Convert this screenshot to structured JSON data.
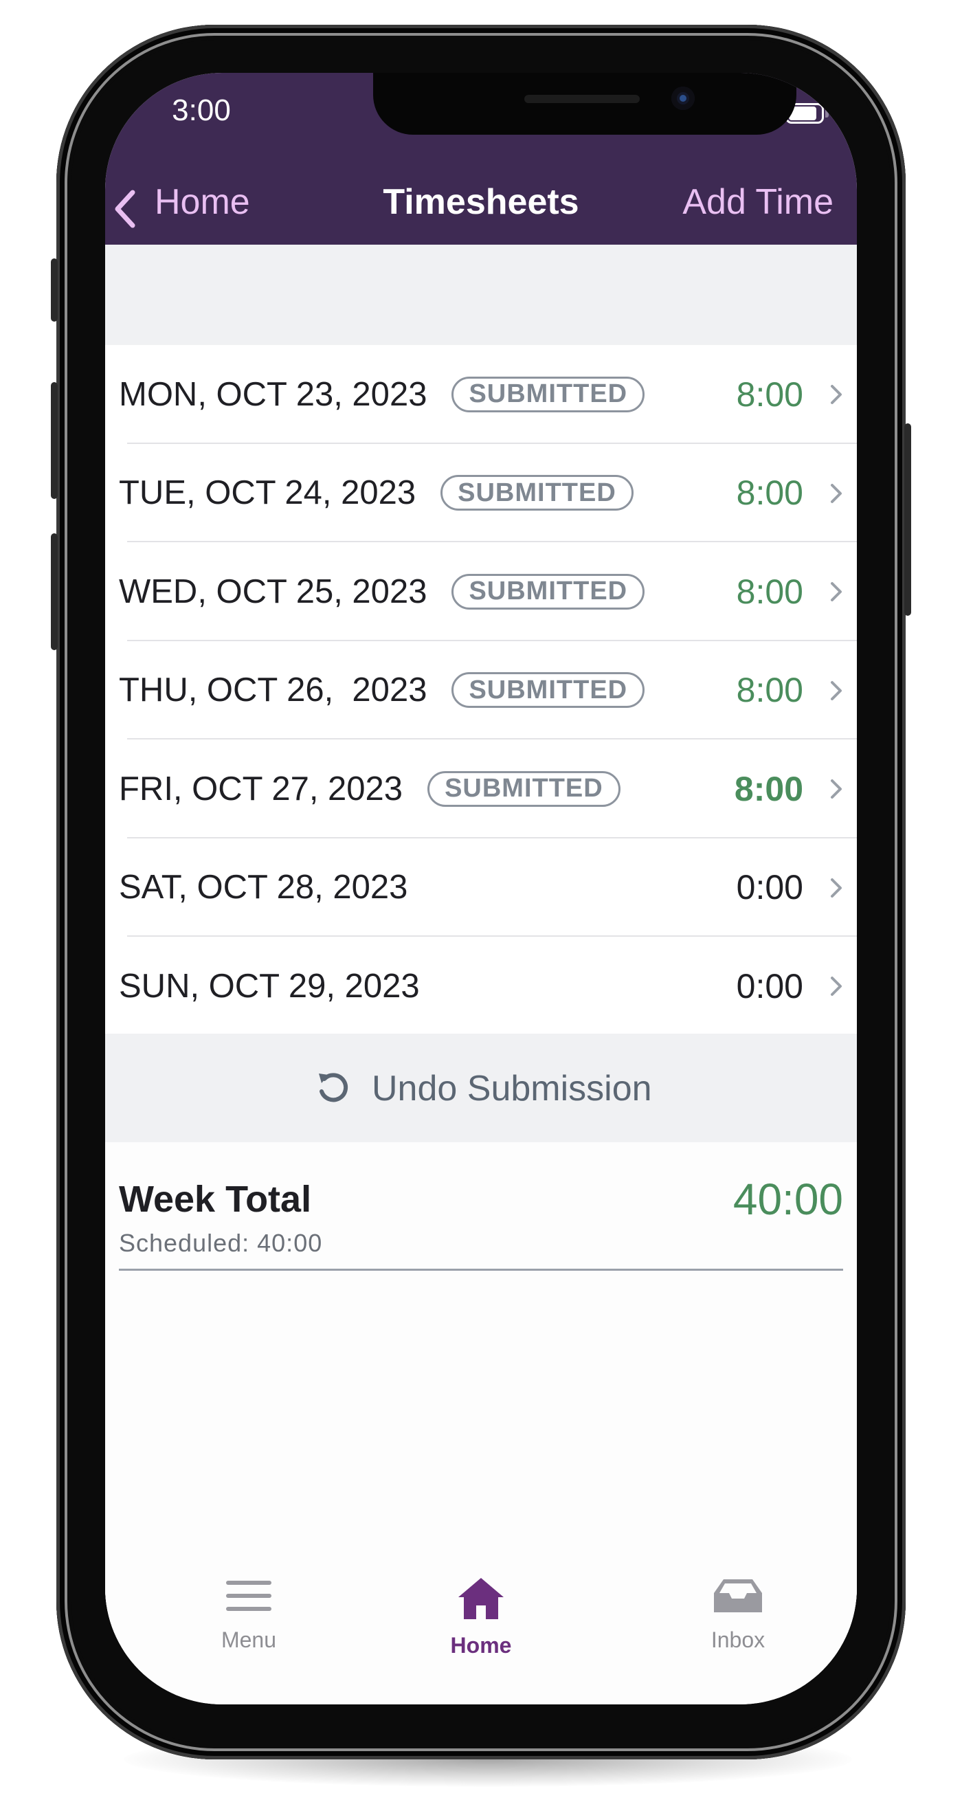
{
  "status_bar": {
    "time": "3:00",
    "signal_icon": "cellular-signal-icon",
    "wifi_icon": "wifi-icon",
    "battery_icon": "battery-icon"
  },
  "nav": {
    "back_label": "Home",
    "back_icon": "chevron-left-icon",
    "title": "Timesheets",
    "action_label": "Add Time"
  },
  "days": [
    {
      "date": "MON, OCT 23, 2023",
      "status": "SUBMITTED",
      "hours": "8:00"
    },
    {
      "date": "TUE, OCT 24, 2023",
      "status": "SUBMITTED",
      "hours": "8:00"
    },
    {
      "date": "WED, OCT 25, 2023",
      "status": "SUBMITTED",
      "hours": "8:00"
    },
    {
      "date": "THU, OCT 26,  2023",
      "status": "SUBMITTED",
      "hours": "8:00"
    },
    {
      "date": "FRI, OCT 27, 2023",
      "status": "SUBMITTED",
      "hours": "8:00"
    },
    {
      "date": "SAT, OCT 28, 2023",
      "status": "",
      "hours": "0:00"
    },
    {
      "date": "SUN, OCT 29, 2023",
      "status": "",
      "hours": "0:00"
    }
  ],
  "undo": {
    "label": "Undo Submission",
    "icon": "undo-icon"
  },
  "week_total": {
    "title": "Week Total",
    "scheduled": "Scheduled: 40:00",
    "value": "40:00"
  },
  "tabbar": {
    "items": [
      {
        "label": "Menu",
        "icon": "hamburger-menu-icon",
        "active": false
      },
      {
        "label": "Home",
        "icon": "home-icon",
        "active": true
      },
      {
        "label": "Inbox",
        "icon": "inbox-tray-icon",
        "active": false
      }
    ]
  },
  "colors": {
    "header_bg": "#3e2a53",
    "nav_accent": "#e9bff2",
    "hours_green": "#4a8d5c",
    "active_tab": "#6b2f7e",
    "badge_gray": "#8d949e"
  }
}
